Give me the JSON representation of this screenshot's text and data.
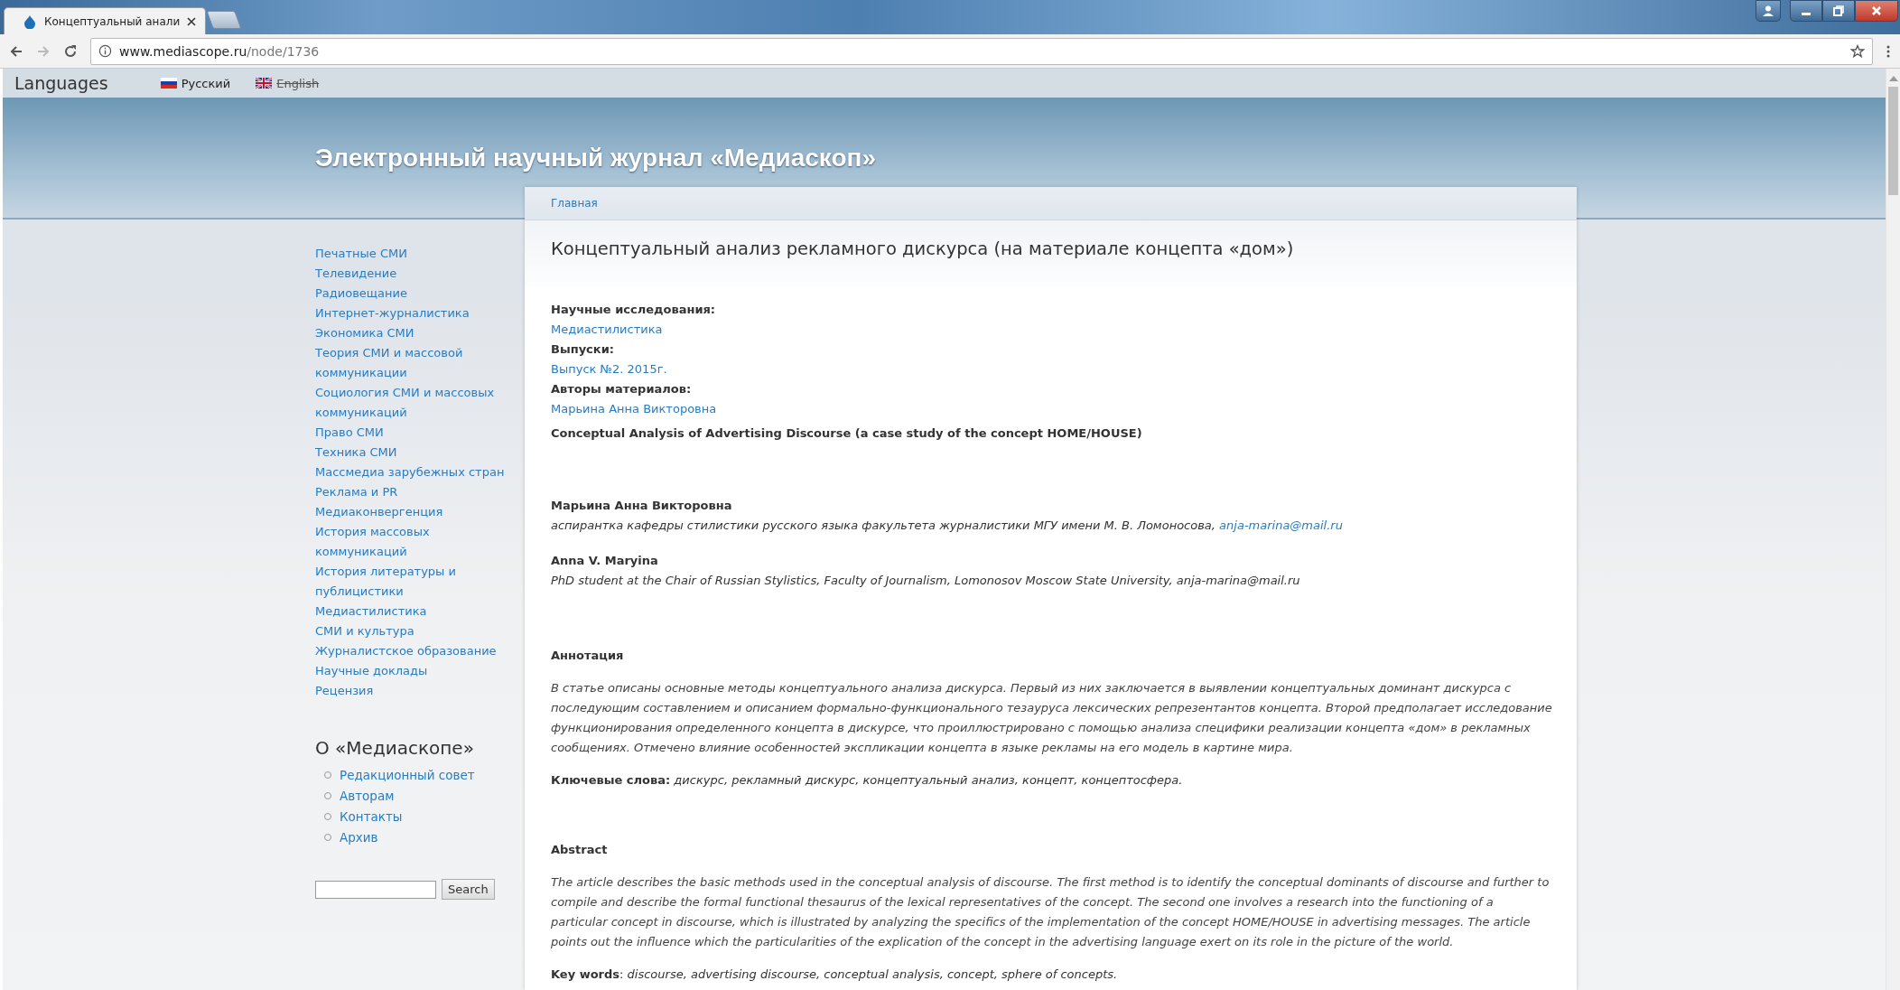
{
  "browser": {
    "tab_title": "Концептуальный анали",
    "url_host": "www.mediascope.ru",
    "url_path": "/node/1736"
  },
  "languages": {
    "title": "Languages",
    "items": [
      {
        "label": "Русский",
        "kind": "ru",
        "disabled": false
      },
      {
        "label": "English",
        "kind": "gb",
        "disabled": true
      }
    ]
  },
  "site_title": "Электронный научный журнал «Медиаскоп»",
  "breadcrumb": "Главная",
  "sidebar": {
    "links": [
      "Печатные СМИ",
      "Телевидение",
      "Радиовещание",
      "Интернет-журналистика",
      "Экономика СМИ",
      "Теория СМИ и массовой коммуникации",
      "Социология СМИ и массовых коммуникаций",
      "Право СМИ",
      "Техника СМИ",
      "Массмедиа зарубежных стран",
      "Реклама и PR",
      "Медиаконвергенция",
      "История массовых коммуникаций",
      "История литературы и публицистики",
      "Медиастилистика",
      "СМИ и культура",
      "Журналистское образование",
      "Научные доклады",
      "Рецензия"
    ],
    "about_title": "О «Медиаскопе»",
    "about_items": [
      "Редакционный совет",
      "Авторам",
      "Контакты",
      "Архив"
    ],
    "search_button": "Search"
  },
  "article": {
    "title": "Концептуальный анализ рекламного дискурса (на материале концепта «дом»)",
    "fields": [
      {
        "label": "Научные исследования:",
        "value": "Медиастилистика"
      },
      {
        "label": "Выпуски:",
        "value": "Выпуск №2. 2015г."
      },
      {
        "label": "Авторы материалов:",
        "value": "Марьина Анна Викторовна"
      }
    ],
    "english_title": "Conceptual Analysis of Advertising Discourse (a case study of the concept HOME/HOUSE)",
    "authors": [
      {
        "name": "Марьина Анна Викторовна",
        "affiliation": "аспирантка кафедры стилистики русского языка факультета журналистики МГУ имени М. В. Ломоносова,",
        "email": "anja-marina@mail.ru"
      },
      {
        "name": "Anna V. Maryina",
        "affiliation": "PhD student at the Chair of Russian Stylistics, Faculty of Journalism, Lomonosov Moscow State University, anja-marina@mail.ru"
      }
    ],
    "sections": [
      {
        "heading": "Аннотация",
        "text": "В статье описаны основные методы концептуального анализа дискурса. Первый из них заключается в выявлении концептуальных доминант дискурса с последующим составлением и описанием формально-функционального тезауруса лексических репрезентантов концепта. Второй предполагает исследование функционирования определенного концепта в дискурсе, что проиллюстрировано с помощью анализа специфики реализации концепта «дом» в рекламных сообщениях. Отмечено влияние особенностей экспликации концепта в языке рекламы на его модель в картине мира.",
        "keywords": "**Ключевые слова:** *дискурс, рекламный дискурс, концептуальный анализ, концепт, концептосфера.*"
      },
      {
        "heading": "Abstract",
        "text": "The article describes the basic methods used in the conceptual analysis of discourse. The first method is to identify the conceptual dominants of discourse and further to compile and describe the formal functional thesaurus of the lexical representatives of the concept. The second one involves a research into the functioning of a particular concept in discourse, which is illustrated by analyzing the specifics of the implementation of the concept HOME/HOUSE in advertising messages. The article points out the influence which the particularities of the explication of the concept in the advertising language exert on its role in the picture of the world.",
        "keywords": "**Key words**: *discourse, advertising discourse, conceptual analysis, concept, sphere of concepts.*"
      }
    ]
  }
}
